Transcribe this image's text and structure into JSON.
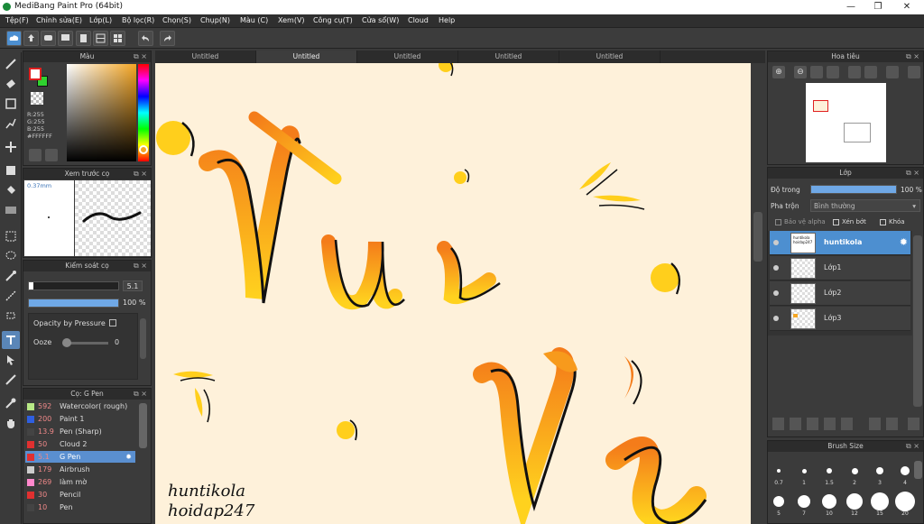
{
  "window": {
    "title": "MediBang Paint Pro (64bit)"
  },
  "menu": [
    "Tệp(F)",
    "Chỉnh sửa(E)",
    "Lớp(L)",
    "Bộ lọc(R)",
    "Chọn(S)",
    "Chụp(N)",
    "Màu (C)",
    "Xem(V)",
    "Công cụ(T)",
    "Cửa sổ(W)",
    "Cloud",
    "Help"
  ],
  "tabs": [
    "Untitled",
    "Untitled",
    "Untitled",
    "Untitled",
    "Untitled"
  ],
  "color_panel": {
    "title": "Màu",
    "r": "R:255",
    "g": "G:255",
    "b": "B:255",
    "hex": "#FFFFFF",
    "primary": "#ffffff",
    "secondary": "#2fd22f"
  },
  "preview_panel": {
    "title": "Xem trước cọ",
    "size": "0.37mm"
  },
  "brush_control": {
    "title": "Kiểm soát cọ",
    "size_value": "5.1",
    "opacity_value": "100 %",
    "size_fraction": 0.05,
    "opacity_fraction": 1.0,
    "opacity_pressure": "Opacity by Pressure",
    "ooze_label": "Ooze",
    "ooze_value": "0"
  },
  "brush_list": {
    "title": "Cọ: G Pen",
    "items": [
      {
        "size": "592",
        "name": "Watercolor( rough)",
        "color": "#b8e986"
      },
      {
        "size": "200",
        "name": "Paint 1",
        "color": "#2f5fe0"
      },
      {
        "size": "13.9",
        "name": "Pen (Sharp)",
        "color": "#444444"
      },
      {
        "size": "50",
        "name": "Cloud 2",
        "color": "#e03030"
      },
      {
        "size": "5.1",
        "name": "G Pen",
        "color": "#e03030"
      },
      {
        "size": "179",
        "name": "Airbrush",
        "color": "#cccccc"
      },
      {
        "size": "269",
        "name": "làm mờ",
        "color": "#ff88cc"
      },
      {
        "size": "30",
        "name": "Pencil",
        "color": "#e03030"
      },
      {
        "size": "10",
        "name": "Pen",
        "color": "#444444"
      }
    ]
  },
  "navigator": {
    "title": "Hoa tiêu"
  },
  "layers_panel": {
    "title": "Lớp",
    "opacity_label": "Độ trong",
    "opacity_value": "100 %",
    "opacity_fraction": 1.0,
    "blend_label": "Pha trộn",
    "blend_value": "Bình thường",
    "protect_alpha": "Bảo vệ alpha",
    "clipping": "Xén bớt",
    "lock": "Khóa",
    "layers": [
      {
        "name": "huntikola",
        "thumb_text": "huntikola hoidap247"
      },
      {
        "name": "Lớp1"
      },
      {
        "name": "Lớp2"
      },
      {
        "name": "Lớp3"
      }
    ]
  },
  "brush_size_panel": {
    "title": "Brush Size",
    "sizes": [
      "0.7",
      "1",
      "1.5",
      "2",
      "3",
      "4",
      "5",
      "7",
      "10",
      "12",
      "15",
      "20"
    ]
  },
  "canvas_text": {
    "line1": "huntikola",
    "line2": "hoidap247",
    "word1": "Vui",
    "word2": "Vẻ"
  },
  "colors": {
    "canvas_bg": "#fef1da",
    "accent": "#4d8fd0",
    "ink": "#111111",
    "orange": "#f47c1a",
    "yellow": "#ffd21e"
  }
}
